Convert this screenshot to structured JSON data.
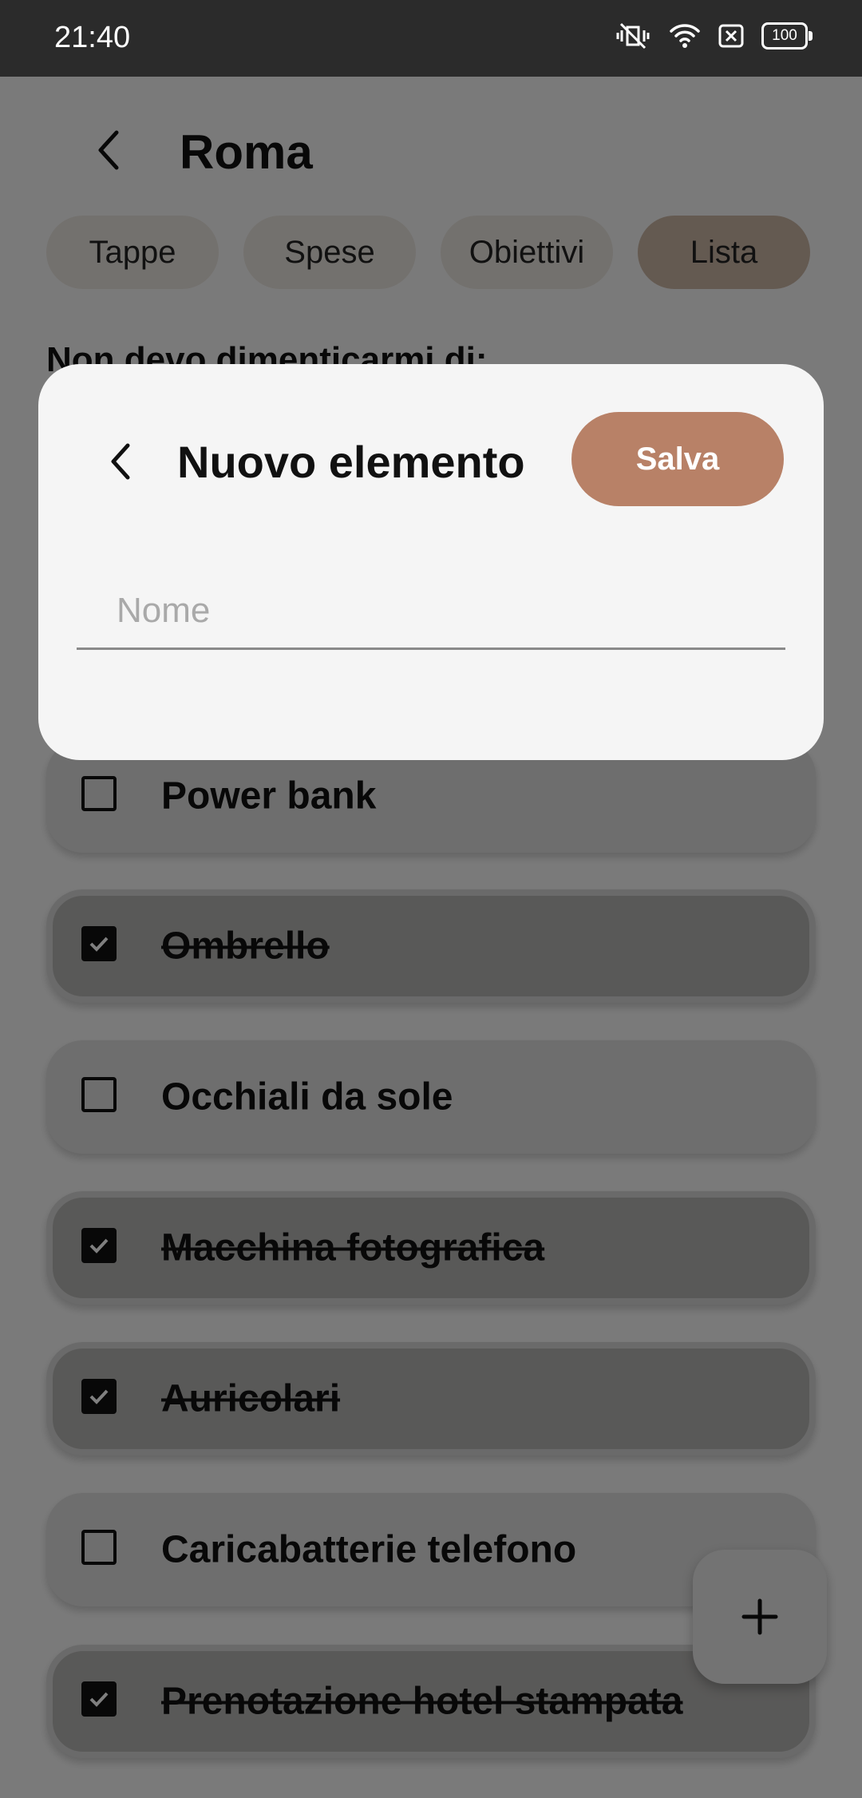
{
  "status_bar": {
    "time": "21:40",
    "battery": "100",
    "icons": [
      "vibrate-off-icon",
      "wifi-icon",
      "sim-off-icon",
      "battery-icon"
    ]
  },
  "header": {
    "title": "Roma",
    "back_icon": "chevron-left-icon"
  },
  "tabs": [
    {
      "label": "Tappe",
      "active": false
    },
    {
      "label": "Spese",
      "active": false
    },
    {
      "label": "Obiettivi",
      "active": false
    },
    {
      "label": "Lista",
      "active": true
    }
  ],
  "list": {
    "heading": "Non devo dimenticarmi di:",
    "items": [
      {
        "label": "Power bank",
        "checked": false
      },
      {
        "label": "Ombrello",
        "checked": true
      },
      {
        "label": "Occhiali da sole",
        "checked": false
      },
      {
        "label": "Macchina fotografica",
        "checked": true
      },
      {
        "label": "Auricolari",
        "checked": true
      },
      {
        "label": "Caricabatterie telefono",
        "checked": false
      },
      {
        "label": "Prenotazione hotel stampata",
        "checked": true
      }
    ]
  },
  "fab": {
    "icon": "plus-icon"
  },
  "dialog": {
    "title": "Nuovo elemento",
    "save_label": "Salva",
    "input_placeholder": "Nome",
    "input_value": ""
  },
  "colors": {
    "accent": "#b88167",
    "active_tab": "#c9b4a3",
    "status_bar": "#2b2b2b"
  }
}
